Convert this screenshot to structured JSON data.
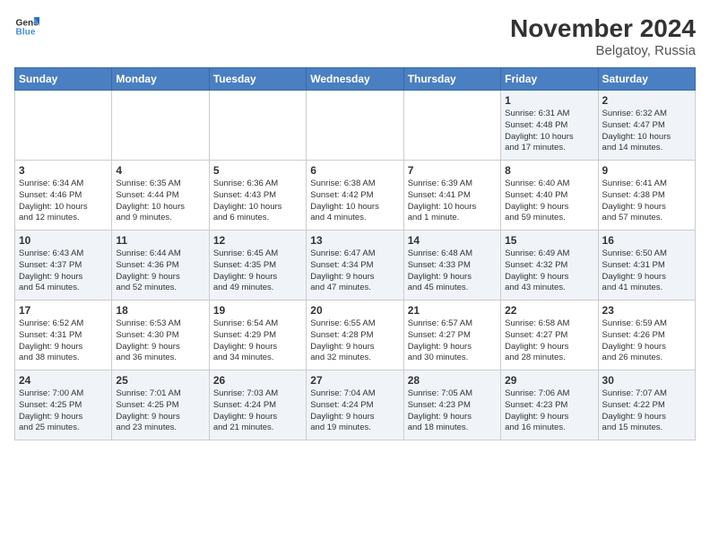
{
  "logo": {
    "line1": "General",
    "line2": "Blue"
  },
  "title": "November 2024",
  "location": "Belgatoy, Russia",
  "days_of_week": [
    "Sunday",
    "Monday",
    "Tuesday",
    "Wednesday",
    "Thursday",
    "Friday",
    "Saturday"
  ],
  "weeks": [
    [
      {
        "day": "",
        "info": ""
      },
      {
        "day": "",
        "info": ""
      },
      {
        "day": "",
        "info": ""
      },
      {
        "day": "",
        "info": ""
      },
      {
        "day": "",
        "info": ""
      },
      {
        "day": "1",
        "info": "Sunrise: 6:31 AM\nSunset: 4:48 PM\nDaylight: 10 hours\nand 17 minutes."
      },
      {
        "day": "2",
        "info": "Sunrise: 6:32 AM\nSunset: 4:47 PM\nDaylight: 10 hours\nand 14 minutes."
      }
    ],
    [
      {
        "day": "3",
        "info": "Sunrise: 6:34 AM\nSunset: 4:46 PM\nDaylight: 10 hours\nand 12 minutes."
      },
      {
        "day": "4",
        "info": "Sunrise: 6:35 AM\nSunset: 4:44 PM\nDaylight: 10 hours\nand 9 minutes."
      },
      {
        "day": "5",
        "info": "Sunrise: 6:36 AM\nSunset: 4:43 PM\nDaylight: 10 hours\nand 6 minutes."
      },
      {
        "day": "6",
        "info": "Sunrise: 6:38 AM\nSunset: 4:42 PM\nDaylight: 10 hours\nand 4 minutes."
      },
      {
        "day": "7",
        "info": "Sunrise: 6:39 AM\nSunset: 4:41 PM\nDaylight: 10 hours\nand 1 minute."
      },
      {
        "day": "8",
        "info": "Sunrise: 6:40 AM\nSunset: 4:40 PM\nDaylight: 9 hours\nand 59 minutes."
      },
      {
        "day": "9",
        "info": "Sunrise: 6:41 AM\nSunset: 4:38 PM\nDaylight: 9 hours\nand 57 minutes."
      }
    ],
    [
      {
        "day": "10",
        "info": "Sunrise: 6:43 AM\nSunset: 4:37 PM\nDaylight: 9 hours\nand 54 minutes."
      },
      {
        "day": "11",
        "info": "Sunrise: 6:44 AM\nSunset: 4:36 PM\nDaylight: 9 hours\nand 52 minutes."
      },
      {
        "day": "12",
        "info": "Sunrise: 6:45 AM\nSunset: 4:35 PM\nDaylight: 9 hours\nand 49 minutes."
      },
      {
        "day": "13",
        "info": "Sunrise: 6:47 AM\nSunset: 4:34 PM\nDaylight: 9 hours\nand 47 minutes."
      },
      {
        "day": "14",
        "info": "Sunrise: 6:48 AM\nSunset: 4:33 PM\nDaylight: 9 hours\nand 45 minutes."
      },
      {
        "day": "15",
        "info": "Sunrise: 6:49 AM\nSunset: 4:32 PM\nDaylight: 9 hours\nand 43 minutes."
      },
      {
        "day": "16",
        "info": "Sunrise: 6:50 AM\nSunset: 4:31 PM\nDaylight: 9 hours\nand 41 minutes."
      }
    ],
    [
      {
        "day": "17",
        "info": "Sunrise: 6:52 AM\nSunset: 4:31 PM\nDaylight: 9 hours\nand 38 minutes."
      },
      {
        "day": "18",
        "info": "Sunrise: 6:53 AM\nSunset: 4:30 PM\nDaylight: 9 hours\nand 36 minutes."
      },
      {
        "day": "19",
        "info": "Sunrise: 6:54 AM\nSunset: 4:29 PM\nDaylight: 9 hours\nand 34 minutes."
      },
      {
        "day": "20",
        "info": "Sunrise: 6:55 AM\nSunset: 4:28 PM\nDaylight: 9 hours\nand 32 minutes."
      },
      {
        "day": "21",
        "info": "Sunrise: 6:57 AM\nSunset: 4:27 PM\nDaylight: 9 hours\nand 30 minutes."
      },
      {
        "day": "22",
        "info": "Sunrise: 6:58 AM\nSunset: 4:27 PM\nDaylight: 9 hours\nand 28 minutes."
      },
      {
        "day": "23",
        "info": "Sunrise: 6:59 AM\nSunset: 4:26 PM\nDaylight: 9 hours\nand 26 minutes."
      }
    ],
    [
      {
        "day": "24",
        "info": "Sunrise: 7:00 AM\nSunset: 4:25 PM\nDaylight: 9 hours\nand 25 minutes."
      },
      {
        "day": "25",
        "info": "Sunrise: 7:01 AM\nSunset: 4:25 PM\nDaylight: 9 hours\nand 23 minutes."
      },
      {
        "day": "26",
        "info": "Sunrise: 7:03 AM\nSunset: 4:24 PM\nDaylight: 9 hours\nand 21 minutes."
      },
      {
        "day": "27",
        "info": "Sunrise: 7:04 AM\nSunset: 4:24 PM\nDaylight: 9 hours\nand 19 minutes."
      },
      {
        "day": "28",
        "info": "Sunrise: 7:05 AM\nSunset: 4:23 PM\nDaylight: 9 hours\nand 18 minutes."
      },
      {
        "day": "29",
        "info": "Sunrise: 7:06 AM\nSunset: 4:23 PM\nDaylight: 9 hours\nand 16 minutes."
      },
      {
        "day": "30",
        "info": "Sunrise: 7:07 AM\nSunset: 4:22 PM\nDaylight: 9 hours\nand 15 minutes."
      }
    ]
  ]
}
